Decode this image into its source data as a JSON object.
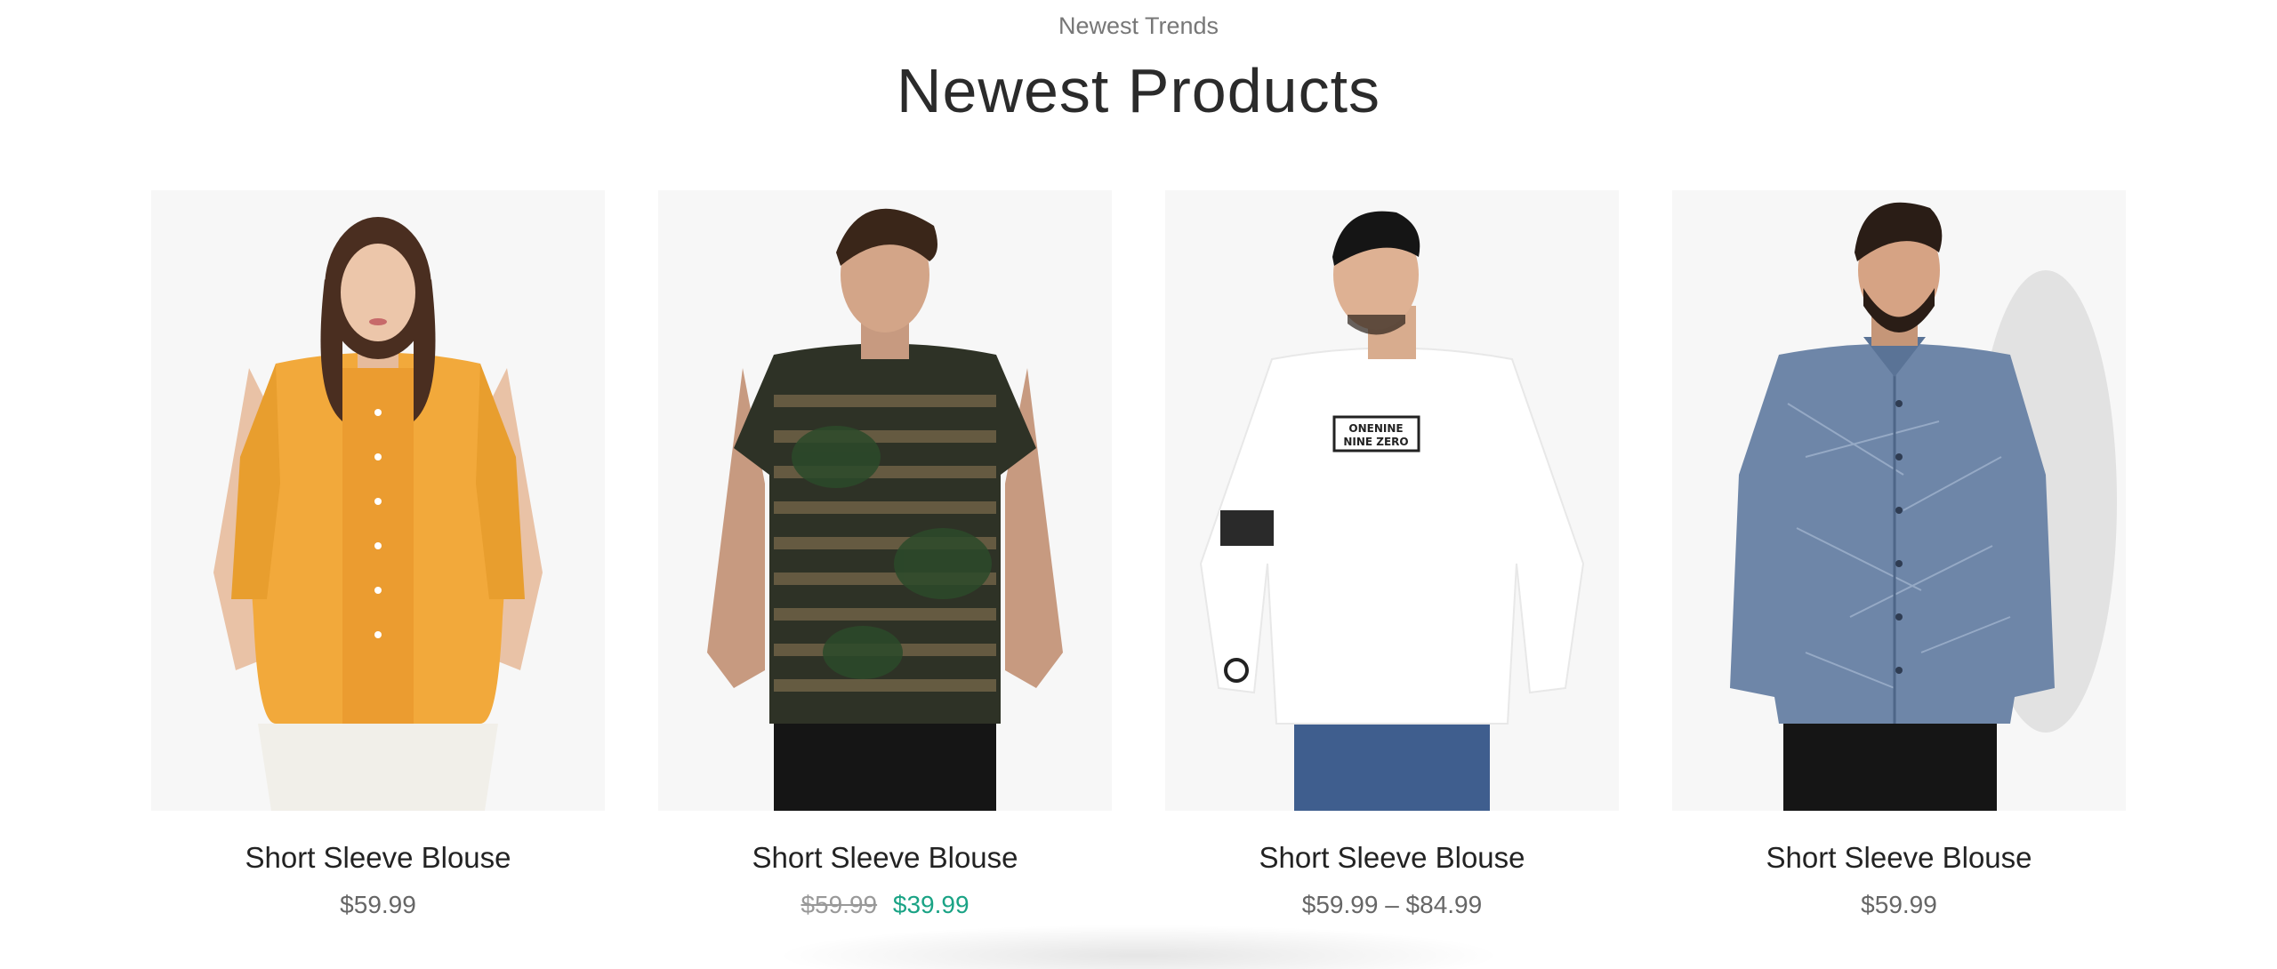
{
  "section": {
    "subtitle": "Newest Trends",
    "title": "Newest Products"
  },
  "products": [
    {
      "name": "Short Sleeve Blouse",
      "price": "$59.99",
      "image": "woman-yellow-blouse",
      "shirt_color": "#f2a93b"
    },
    {
      "name": "Short Sleeve Blouse",
      "old_price": "$59.99",
      "sale_price": "$39.99",
      "image": "man-camo-tshirt",
      "shirt_color": "#3b3f2e"
    },
    {
      "name": "Short Sleeve Blouse",
      "price": "$59.99 – $84.99",
      "image": "man-white-longsleeve",
      "shirt_color": "#ffffff",
      "shirt_print": [
        "ONENINE",
        "NINE ZERO"
      ]
    },
    {
      "name": "Short Sleeve Blouse",
      "price": "$59.99",
      "image": "man-denim-shirt",
      "shirt_color": "#6e86a8"
    }
  ],
  "colors": {
    "sale": "#1aa385",
    "image_bg": "#f7f7f7"
  }
}
